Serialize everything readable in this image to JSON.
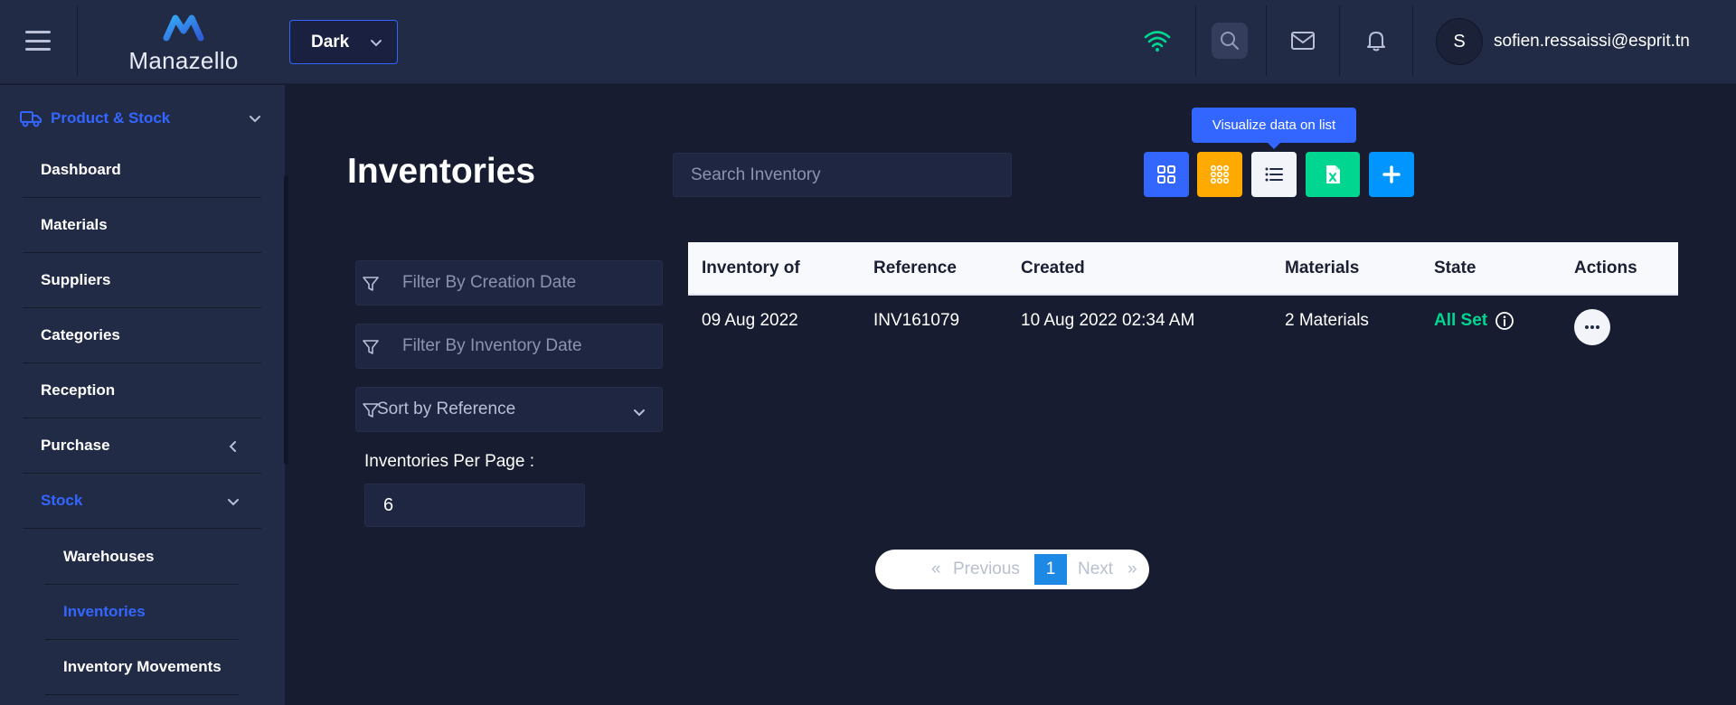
{
  "header": {
    "logo_text": "Manazello",
    "theme": {
      "value": "Dark"
    },
    "user": {
      "initial": "S",
      "email": "sofien.ressaissi@esprit.tn"
    }
  },
  "sidebar": {
    "group": {
      "label": "Product & Stock"
    },
    "items": [
      {
        "label": "Dashboard"
      },
      {
        "label": "Materials"
      },
      {
        "label": "Suppliers"
      },
      {
        "label": "Categories"
      },
      {
        "label": "Reception"
      },
      {
        "label": "Purchase"
      },
      {
        "label": "Stock"
      }
    ],
    "sub_items": [
      {
        "label": "Warehouses"
      },
      {
        "label": "Inventories"
      },
      {
        "label": "Inventory Movements"
      }
    ]
  },
  "main": {
    "title": "Inventories",
    "search": {
      "placeholder": "Search Inventory"
    },
    "tooltip": "Visualize data on list",
    "filters": {
      "creation_date": "Filter By Creation Date",
      "inventory_date": "Filter By Inventory Date",
      "sort": "Sort by Reference"
    },
    "per_page": {
      "label": "Inventories Per Page :",
      "value": "6"
    },
    "table": {
      "headers": [
        "Inventory of",
        "Reference",
        "Created",
        "Materials",
        "State",
        "Actions"
      ],
      "rows": [
        {
          "inventory_of": "09 Aug 2022",
          "reference": "INV161079",
          "created": "10 Aug 2022 02:34 AM",
          "materials": "2 Materials",
          "state": "All Set"
        }
      ]
    },
    "pagination": {
      "prev_arrow": "«",
      "previous": "Previous",
      "current": "1",
      "next": "Next",
      "next_arrow": "»"
    }
  },
  "colors": {
    "accent": "#3366ff",
    "success": "#00d68f",
    "warning": "#ffaa00",
    "background": "#171c30",
    "panel": "#222b45"
  }
}
